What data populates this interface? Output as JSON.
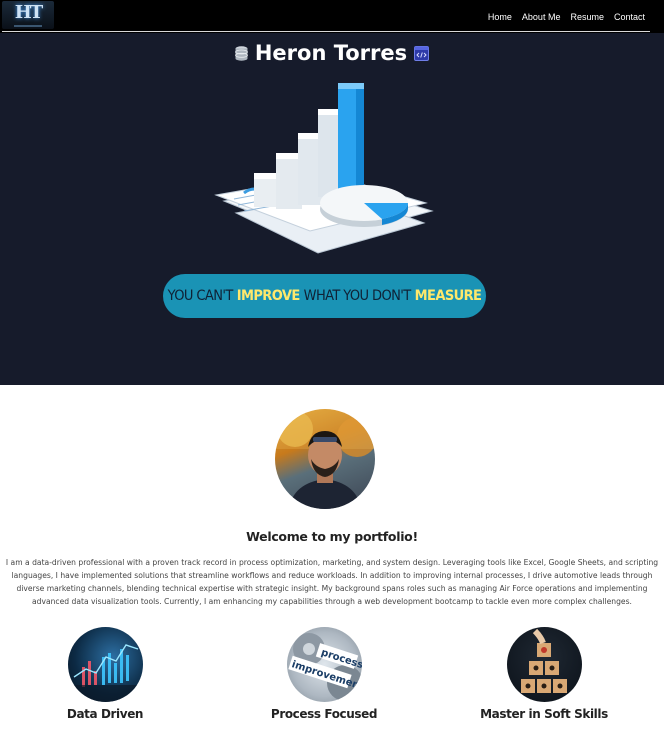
{
  "nav": {
    "logo_text": "HT",
    "links": [
      "Home",
      "About Me",
      "Resume",
      "Contact"
    ]
  },
  "hero": {
    "title": "Heron Torres",
    "slogan": {
      "p1": "YOU CAN'T",
      "p2": "IMPROVE",
      "p3": "WHAT YOU DON'T",
      "p4": "MEASURE"
    }
  },
  "about": {
    "welcome": "Welcome to my portfolio!",
    "bio": "I am a data-driven professional with a proven track record in process optimization, marketing, and system design. Leveraging tools like Excel, Google Sheets, and scripting languages, I have implemented solutions that streamline workflows and reduce workloads. In addition to improving internal processes, I drive automotive leads through diverse marketing channels, blending technical expertise with strategic insight. My background spans roles such as managing Air Force operations and implementing advanced data visualization tools. Currently, I am enhancing my capabilities through a web development bootcamp to tackle even more complex challenges."
  },
  "features": [
    {
      "label": "Data Driven",
      "icon": "data-chart-image"
    },
    {
      "label": "Process Focused",
      "icon": "gears-image",
      "image_text_1": "process",
      "image_text_2": "improvement"
    },
    {
      "label": "Master in Soft Skills",
      "icon": "blocks-image"
    }
  ],
  "colors": {
    "nav_bg": "#000000",
    "hero_bg": "#161b2b",
    "slogan_bg": "#1a93b5",
    "highlight": "#ffe86b"
  }
}
